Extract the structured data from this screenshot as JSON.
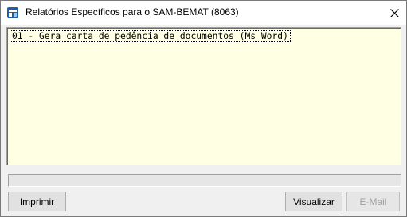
{
  "window": {
    "title": "Relatórios Específicos para o SAM-BEMAT (8063)"
  },
  "list": {
    "items": [
      "01 - Gera carta de pedência de documentos  (Ms Word)"
    ]
  },
  "progress": {
    "value": 0
  },
  "buttons": {
    "imprimir": "Imprimir",
    "visualizar": "Visualizar",
    "email": "E-Mail"
  },
  "icons": {
    "app": "app-icon",
    "close": "close-icon"
  }
}
